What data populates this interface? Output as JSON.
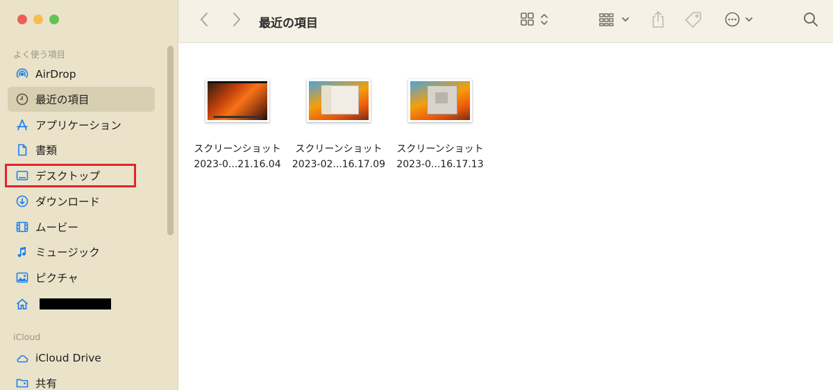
{
  "window": {
    "traffic_lights": {
      "close": "#ee5e56",
      "minimize": "#f5bd4f",
      "maximize": "#61c554"
    },
    "title": "最近の項目"
  },
  "toolbar": {
    "back_icon": "chevron-left-icon",
    "forward_icon": "chevron-right-icon",
    "view_icon": "grid-view-icon",
    "group_icon": "group-by-icon",
    "share_icon": "share-icon",
    "tag_icon": "tag-icon",
    "action_icon": "ellipsis-circle-icon",
    "search_icon": "magnifier-icon"
  },
  "sidebar": {
    "favorites_label": "よく使う項目",
    "items": [
      {
        "label": "AirDrop",
        "icon": "airdrop-icon"
      },
      {
        "label": "最近の項目",
        "icon": "clock-icon",
        "selected": true
      },
      {
        "label": "アプリケーション",
        "icon": "applications-icon"
      },
      {
        "label": "書類",
        "icon": "document-icon"
      },
      {
        "label": "デスクトップ",
        "icon": "desktop-icon",
        "highlighted": true
      },
      {
        "label": "ダウンロード",
        "icon": "download-icon"
      },
      {
        "label": "ムービー",
        "icon": "film-icon"
      },
      {
        "label": "ミュージック",
        "icon": "music-note-icon"
      },
      {
        "label": "ピクチャ",
        "icon": "photo-icon"
      },
      {
        "label": "",
        "icon": "home-icon",
        "redacted": true
      }
    ],
    "icloud_label": "iCloud",
    "icloud_items": [
      {
        "label": "iCloud Drive",
        "icon": "cloud-icon"
      },
      {
        "label": "共有",
        "icon": "shared-folder-icon"
      }
    ]
  },
  "files": [
    {
      "name_line1": "スクリーンショット",
      "name_line2": "2023-0...21.16.04"
    },
    {
      "name_line1": "スクリーンショット",
      "name_line2": "2023-02...16.17.09"
    },
    {
      "name_line1": "スクリーンショット",
      "name_line2": "2023-0...16.17.13"
    }
  ],
  "colors": {
    "accent": "#1a7ff0",
    "highlight_box": "#e0242c",
    "sidebar_bg": "#eae3c9",
    "selected_bg": "#d7cfb1"
  }
}
